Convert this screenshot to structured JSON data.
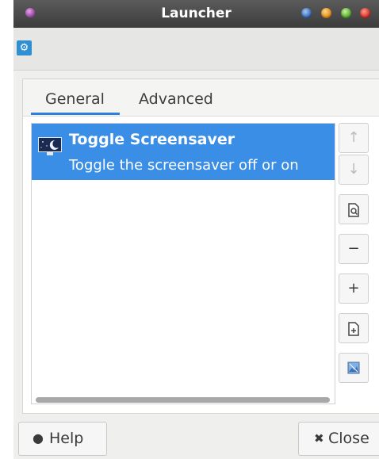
{
  "window": {
    "title": "Launcher"
  },
  "tabs": [
    {
      "label": "General",
      "active": true
    },
    {
      "label": "Advanced",
      "active": false
    }
  ],
  "items": [
    {
      "name": "Toggle Screensaver",
      "description": "Toggle the screensaver off or on",
      "selected": true
    }
  ],
  "side_buttons": [
    {
      "name": "move-up",
      "icon": "up-arrow-icon",
      "enabled": false
    },
    {
      "name": "move-down",
      "icon": "down-arrow-icon",
      "enabled": false
    },
    {
      "name": "item-properties",
      "icon": "document-search-icon",
      "enabled": true
    },
    {
      "name": "remove-item",
      "icon": "minus-icon",
      "enabled": true
    },
    {
      "name": "add-item",
      "icon": "plus-icon",
      "enabled": true
    },
    {
      "name": "new-item",
      "icon": "document-new-icon",
      "enabled": true
    },
    {
      "name": "edit-item",
      "icon": "image-edit-icon",
      "enabled": true
    }
  ],
  "footer": {
    "help_label": "Help",
    "close_label": "Close"
  },
  "colors": {
    "accent": "#3a8ee6",
    "titlebar": "#4a4a4a"
  }
}
